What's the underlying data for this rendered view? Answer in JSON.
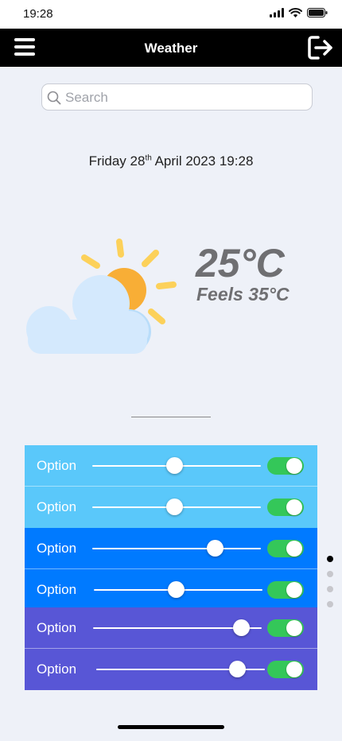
{
  "status_bar": {
    "time": "19:28"
  },
  "nav": {
    "title": "Weather"
  },
  "search": {
    "placeholder": "Search"
  },
  "date": {
    "prefix": "Friday 28",
    "ordinal": "th",
    "suffix": " April 2023 19:28"
  },
  "weather": {
    "temperature": "25°C",
    "feels_like": "Feels 35°C",
    "icon": "sun-behind-cloud-icon"
  },
  "options": [
    {
      "label": "Option",
      "slider_value": 0.49,
      "toggle_on": true,
      "color": "#5ac8fa"
    },
    {
      "label": "Option",
      "slider_value": 0.49,
      "toggle_on": true,
      "color": "#5ac8fa"
    },
    {
      "label": "Option",
      "slider_value": 0.73,
      "toggle_on": true,
      "color": "#007aff"
    },
    {
      "label": "Option",
      "slider_value": 0.49,
      "toggle_on": true,
      "color": "#007aff"
    },
    {
      "label": "Option",
      "slider_value": 0.88,
      "toggle_on": true,
      "color": "#5856d6"
    },
    {
      "label": "Option",
      "slider_value": 0.84,
      "toggle_on": true,
      "color": "#5856d6"
    }
  ],
  "pagination": {
    "total": 4,
    "current": 1
  },
  "colors": {
    "toggle_on": "#34c759",
    "nav_bg": "#000000",
    "background": "#eef1f8"
  }
}
